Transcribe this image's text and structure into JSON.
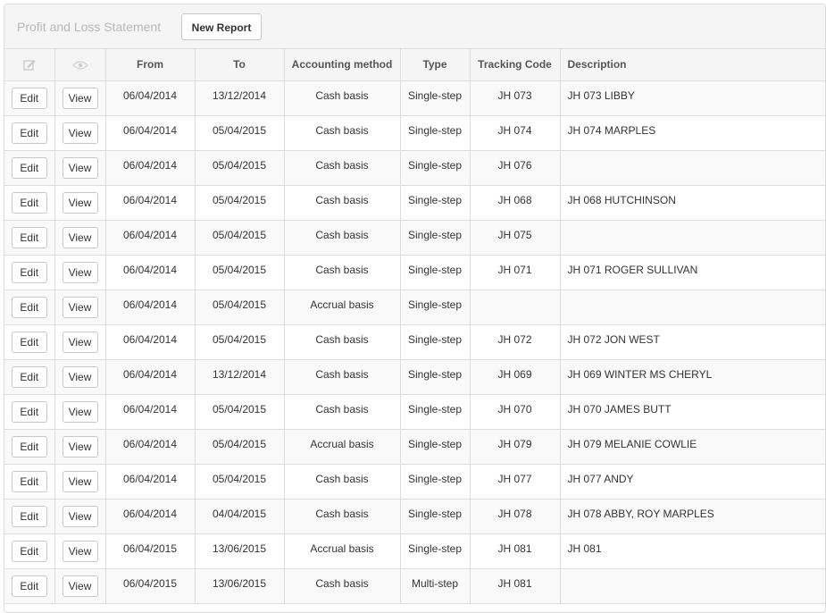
{
  "panel": {
    "title": "Profit and Loss Statement",
    "new_report_label": "New Report"
  },
  "table": {
    "header_icons": {
      "edit": "edit-icon",
      "view": "eye-icon"
    },
    "columns": [
      "From",
      "To",
      "Accounting method",
      "Type",
      "Tracking Code",
      "Description"
    ],
    "edit_label": "Edit",
    "view_label": "View",
    "rows": [
      {
        "from": "06/04/2014",
        "to": "13/12/2014",
        "method": "Cash basis",
        "type": "Single-step",
        "code": "JH 073",
        "desc": "JH 073 LIBBY"
      },
      {
        "from": "06/04/2014",
        "to": "05/04/2015",
        "method": "Cash basis",
        "type": "Single-step",
        "code": "JH 074",
        "desc": "JH 074 MARPLES"
      },
      {
        "from": "06/04/2014",
        "to": "05/04/2015",
        "method": "Cash basis",
        "type": "Single-step",
        "code": "JH 076",
        "desc": ""
      },
      {
        "from": "06/04/2014",
        "to": "05/04/2015",
        "method": "Cash basis",
        "type": "Single-step",
        "code": "JH 068",
        "desc": "JH 068 HUTCHINSON"
      },
      {
        "from": "06/04/2014",
        "to": "05/04/2015",
        "method": "Cash basis",
        "type": "Single-step",
        "code": "JH 075",
        "desc": ""
      },
      {
        "from": "06/04/2014",
        "to": "05/04/2015",
        "method": "Cash basis",
        "type": "Single-step",
        "code": "JH 071",
        "desc": "JH 071 ROGER SULLIVAN"
      },
      {
        "from": "06/04/2014",
        "to": "05/04/2015",
        "method": "Accrual basis",
        "type": "Single-step",
        "code": "",
        "desc": ""
      },
      {
        "from": "06/04/2014",
        "to": "05/04/2015",
        "method": "Cash basis",
        "type": "Single-step",
        "code": "JH 072",
        "desc": "JH 072 JON WEST"
      },
      {
        "from": "06/04/2014",
        "to": "13/12/2014",
        "method": "Cash basis",
        "type": "Single-step",
        "code": "JH 069",
        "desc": "JH 069 WINTER MS CHERYL"
      },
      {
        "from": "06/04/2014",
        "to": "05/04/2015",
        "method": "Cash basis",
        "type": "Single-step",
        "code": "JH 070",
        "desc": "JH 070 JAMES BUTT"
      },
      {
        "from": "06/04/2014",
        "to": "05/04/2015",
        "method": "Accrual basis",
        "type": "Single-step",
        "code": "JH 079",
        "desc": "JH 079 MELANIE COWLIE"
      },
      {
        "from": "06/04/2014",
        "to": "05/04/2015",
        "method": "Cash basis",
        "type": "Single-step",
        "code": "JH 077",
        "desc": "JH 077 ANDY"
      },
      {
        "from": "06/04/2014",
        "to": "04/04/2015",
        "method": "Cash basis",
        "type": "Single-step",
        "code": "JH 078",
        "desc": "JH 078 ABBY, ROY MARPLES"
      },
      {
        "from": "06/04/2015",
        "to": "13/06/2015",
        "method": "Accrual basis",
        "type": "Single-step",
        "code": "JH 081",
        "desc": "JH 081"
      },
      {
        "from": "06/04/2015",
        "to": "13/06/2015",
        "method": "Cash basis",
        "type": "Multi-step",
        "code": "JH 081",
        "desc": ""
      }
    ]
  }
}
